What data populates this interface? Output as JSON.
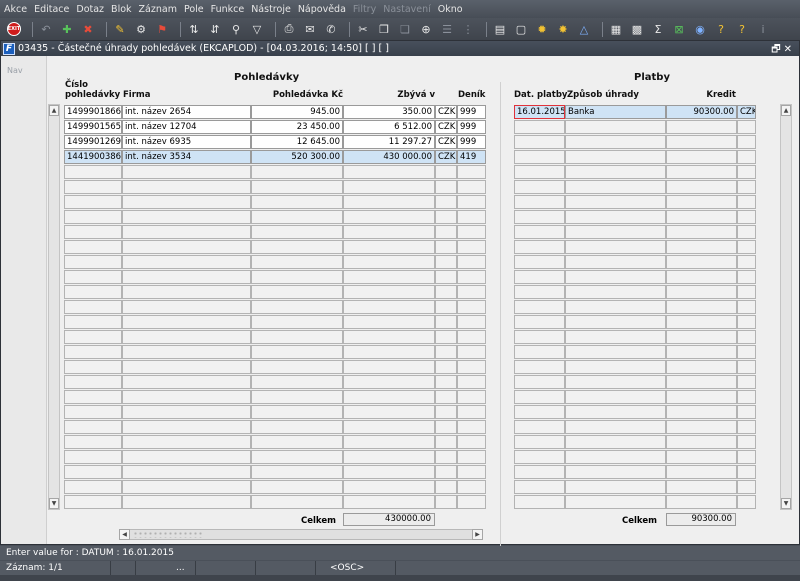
{
  "menu": [
    "Akce",
    "Editace",
    "Dotaz",
    "Blok",
    "Záznam",
    "Pole",
    "Funkce",
    "Nástroje",
    "Nápověda",
    "Filtry",
    "Nastavení",
    "Okno"
  ],
  "menu_disabled": [
    "Filtry",
    "Nastavení"
  ],
  "toolbar": {
    "exit_label": "EXIT"
  },
  "window": {
    "title": "03435 - Částečné úhrady pohledávek (EKCAPLOD) - [04.03.2016; 14:50] [ ] [ ]",
    "controls": "🗗✕",
    "nav_label": "Nav"
  },
  "left": {
    "title": "Pohledávky",
    "columns": [
      "Číslo pohledávky",
      "Firma",
      "Pohledávka Kč",
      "Zbývá v",
      "Deník"
    ],
    "rows": [
      {
        "cislo": "1499901866",
        "firma": "int. název 2654",
        "pohledavka": "945.00",
        "zbyva": "350.00",
        "mena": "CZK",
        "denik": "999"
      },
      {
        "cislo": "1499901565",
        "firma": "int. název 12704",
        "pohledavka": "23 450.00",
        "zbyva": "6 512.00",
        "mena": "CZK",
        "denik": "999"
      },
      {
        "cislo": "1499901269",
        "firma": "int. název 6935",
        "pohledavka": "12 645.00",
        "zbyva": "11 297.27",
        "mena": "CZK",
        "denik": "999"
      },
      {
        "cislo": "1441900386",
        "firma": "int. název 3534",
        "pohledavka": "520 300.00",
        "zbyva": "430 000.00",
        "mena": "CZK",
        "denik": "419"
      }
    ],
    "total_label": "Celkem",
    "total_value": "430000.00"
  },
  "right": {
    "title": "Platby",
    "columns": [
      "Dat. platby",
      "Způsob úhrady",
      "Kredit"
    ],
    "rows": [
      {
        "datum": "16.01.2015",
        "zpusob": "Banka",
        "kredit": "90300.00",
        "mena": "CZK"
      }
    ],
    "total_label": "Celkem",
    "total_value": "90300.00"
  },
  "status": {
    "message": "Enter value for : DATUM : 16.01.2015",
    "record": "Záznam: 1/1",
    "seg3": "...",
    "mode": "<OSC>"
  }
}
